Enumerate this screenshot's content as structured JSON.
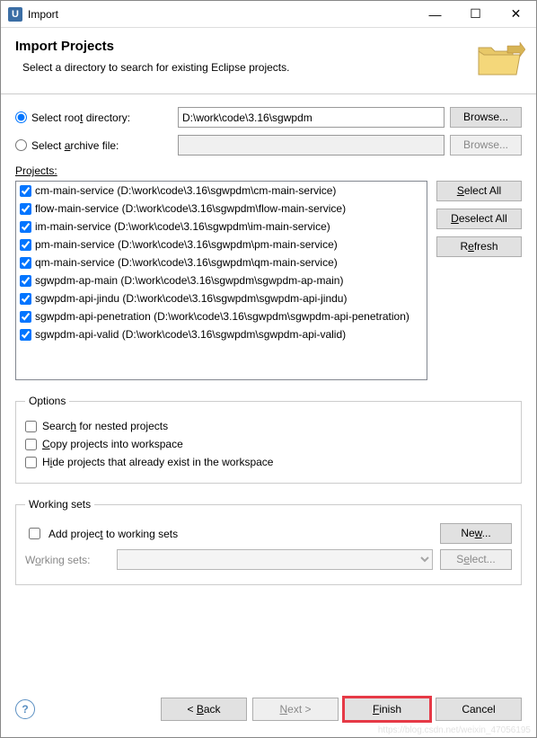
{
  "titlebar": {
    "title": "Import"
  },
  "header": {
    "title": "Import Projects",
    "subtitle": "Select a directory to search for existing Eclipse projects."
  },
  "source": {
    "root_label": "Select root directory:",
    "archive_label": "Select archive file:",
    "root_value": "D:\\work\\code\\3.16\\sgwpdm",
    "archive_value": "",
    "browse_btn": "Browse...",
    "browse_btn_disabled": "Browse..."
  },
  "projects": {
    "label": "Projects:",
    "items": [
      "cm-main-service (D:\\work\\code\\3.16\\sgwpdm\\cm-main-service)",
      "flow-main-service (D:\\work\\code\\3.16\\sgwpdm\\flow-main-service)",
      "im-main-service (D:\\work\\code\\3.16\\sgwpdm\\im-main-service)",
      "pm-main-service (D:\\work\\code\\3.16\\sgwpdm\\pm-main-service)",
      "qm-main-service (D:\\work\\code\\3.16\\sgwpdm\\qm-main-service)",
      "sgwpdm-ap-main (D:\\work\\code\\3.16\\sgwpdm\\sgwpdm-ap-main)",
      "sgwpdm-api-jindu (D:\\work\\code\\3.16\\sgwpdm\\sgwpdm-api-jindu)",
      "sgwpdm-api-penetration (D:\\work\\code\\3.16\\sgwpdm\\sgwpdm-api-penetration)",
      "sgwpdm-api-valid (D:\\work\\code\\3.16\\sgwpdm\\sgwpdm-api-valid)"
    ],
    "select_all": "Select All",
    "deselect_all": "Deselect All",
    "refresh": "Refresh"
  },
  "options": {
    "legend": "Options",
    "search_nested": "Search for nested projects",
    "copy_projects": "Copy projects into workspace",
    "hide_existing": "Hide projects that already exist in the workspace"
  },
  "working_sets": {
    "legend": "Working sets",
    "add_label": "Add project to working sets",
    "new_btn": "New...",
    "ws_label": "Working sets:",
    "select_btn": "Select..."
  },
  "footer": {
    "back": "< Back",
    "next": "Next >",
    "finish": "Finish",
    "cancel": "Cancel"
  },
  "watermark": "https://blog.csdn.net/weixin_47056195"
}
